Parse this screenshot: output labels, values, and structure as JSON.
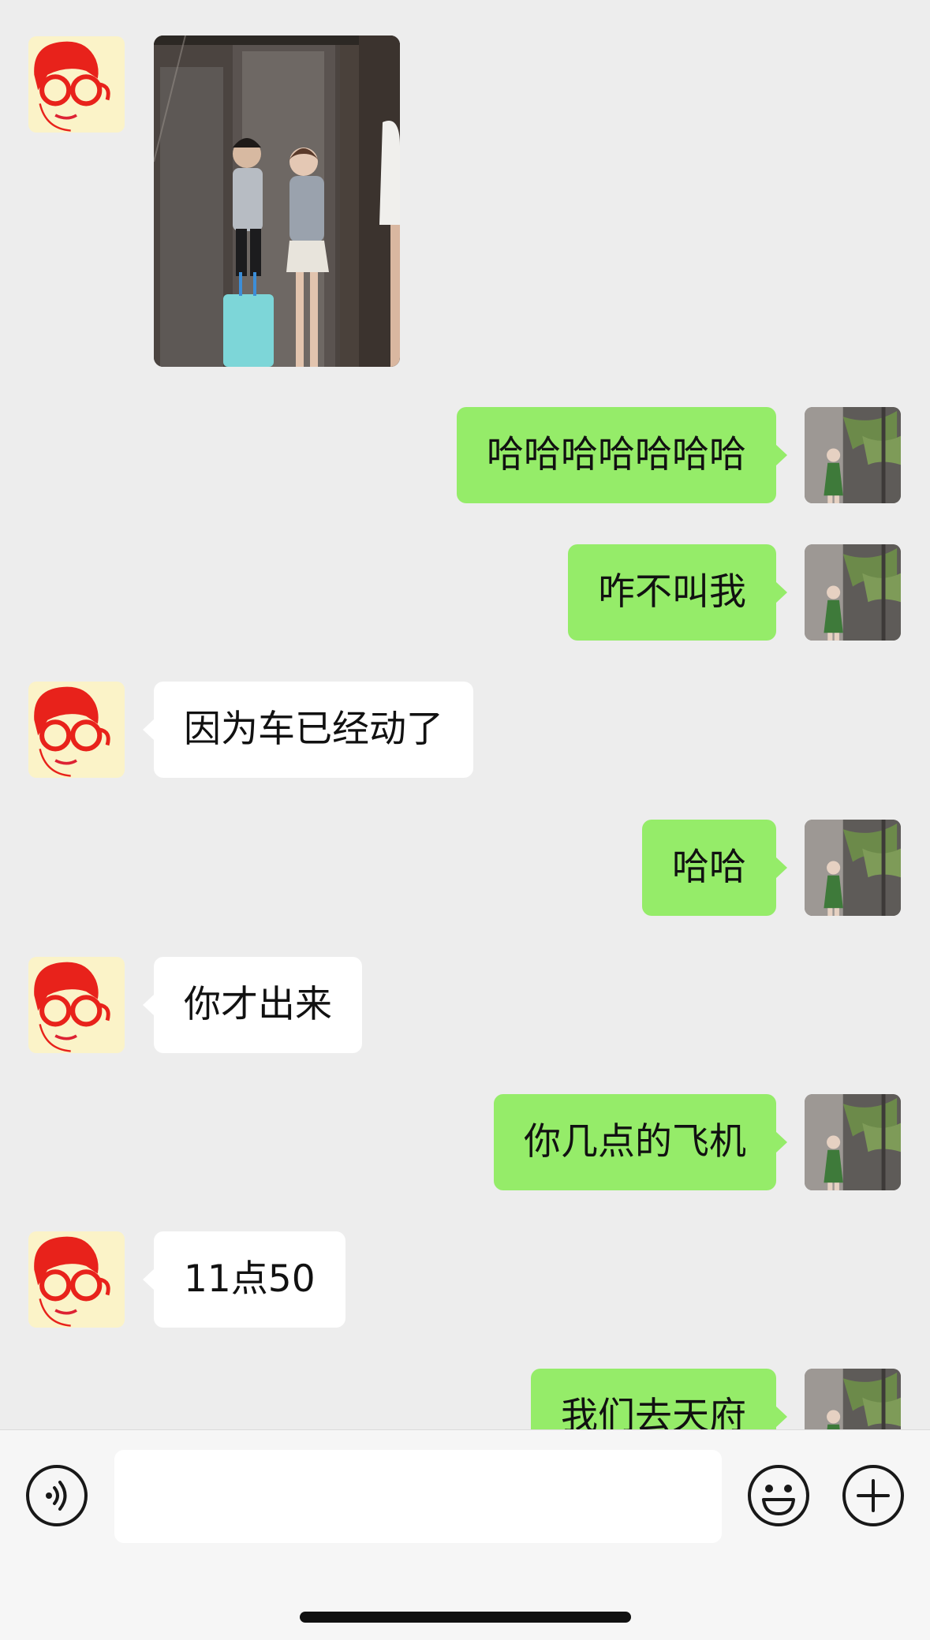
{
  "messages": [
    {
      "side": "in",
      "type": "image",
      "alt": ""
    },
    {
      "side": "out",
      "type": "text",
      "text": "哈哈哈哈哈哈哈"
    },
    {
      "side": "out",
      "type": "text",
      "text": "咋不叫我"
    },
    {
      "side": "in",
      "type": "text",
      "text": "因为车已经动了"
    },
    {
      "side": "out",
      "type": "text",
      "text": "哈哈"
    },
    {
      "side": "in",
      "type": "text",
      "text": "你才出来"
    },
    {
      "side": "out",
      "type": "text",
      "text": "你几点的飞机"
    },
    {
      "side": "in",
      "type": "text",
      "text": "11点50"
    },
    {
      "side": "out",
      "type": "text",
      "text": "我们去天府"
    }
  ],
  "input_bar": {
    "message_value": "",
    "voice_icon": "voice-icon",
    "emoji_icon": "emoji-icon",
    "plus_icon": "plus-icon"
  },
  "colors": {
    "background": "#ededed",
    "outgoing_bubble": "#95ec69",
    "incoming_bubble": "#ffffff"
  }
}
